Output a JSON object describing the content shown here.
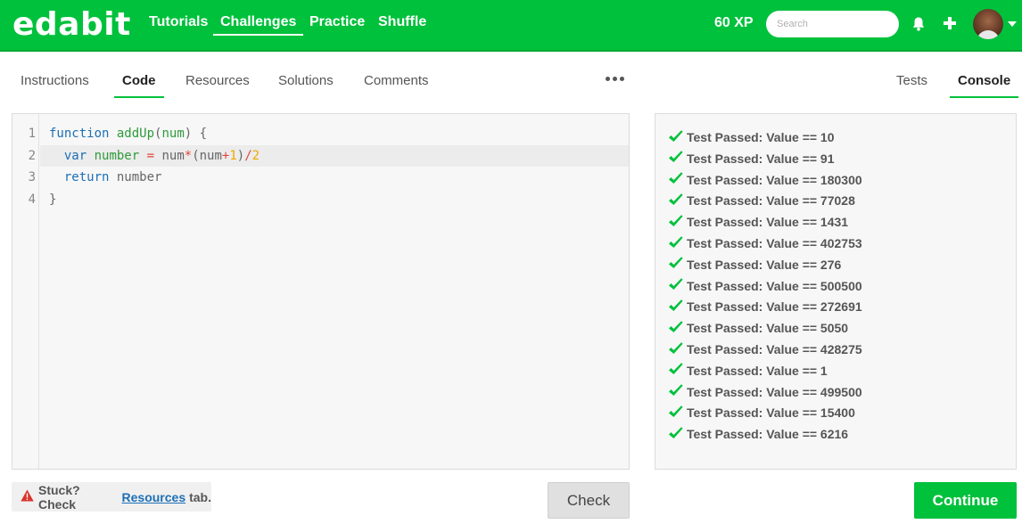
{
  "header": {
    "logo": "edabit",
    "nav": [
      "Tutorials",
      "Challenges",
      "Practice",
      "Shuffle"
    ],
    "active_nav": "Challenges",
    "xp": "60 XP",
    "search_placeholder": "Search"
  },
  "tabs": {
    "left": [
      "Instructions",
      "Code",
      "Resources",
      "Solutions",
      "Comments"
    ],
    "left_active": "Code",
    "right": [
      "Tests",
      "Console"
    ],
    "right_active": "Console"
  },
  "editor": {
    "line_numbers": [
      "1",
      "2",
      "3",
      "4"
    ],
    "highlighted_line": "2",
    "lines": [
      [
        {
          "t": "function",
          "c": "kw"
        },
        {
          "t": " ",
          "c": "punc"
        },
        {
          "t": "addUp",
          "c": "fn"
        },
        {
          "t": "(",
          "c": "punc"
        },
        {
          "t": "num",
          "c": "var"
        },
        {
          "t": ") {",
          "c": "punc"
        }
      ],
      [
        {
          "t": "  ",
          "c": "punc"
        },
        {
          "t": "var",
          "c": "kw"
        },
        {
          "t": " ",
          "c": "punc"
        },
        {
          "t": "number",
          "c": "var"
        },
        {
          "t": " ",
          "c": "punc"
        },
        {
          "t": "=",
          "c": "op"
        },
        {
          "t": " num",
          "c": "id"
        },
        {
          "t": "*",
          "c": "op"
        },
        {
          "t": "(num",
          "c": "id"
        },
        {
          "t": "+",
          "c": "op"
        },
        {
          "t": "1",
          "c": "num"
        },
        {
          "t": ")",
          "c": "id"
        },
        {
          "t": "/",
          "c": "op"
        },
        {
          "t": "2",
          "c": "num"
        }
      ],
      [
        {
          "t": "  ",
          "c": "punc"
        },
        {
          "t": "return",
          "c": "kw"
        },
        {
          "t": " number",
          "c": "id"
        }
      ],
      [
        {
          "t": "}",
          "c": "punc"
        }
      ]
    ]
  },
  "console": {
    "results": [
      "Test Passed: Value == 10",
      "Test Passed: Value == 91",
      "Test Passed: Value == 180300",
      "Test Passed: Value == 77028",
      "Test Passed: Value == 1431",
      "Test Passed: Value == 402753",
      "Test Passed: Value == 276",
      "Test Passed: Value == 500500",
      "Test Passed: Value == 272691",
      "Test Passed: Value == 5050",
      "Test Passed: Value == 428275",
      "Test Passed: Value == 1",
      "Test Passed: Value == 499500",
      "Test Passed: Value == 15400",
      "Test Passed: Value == 6216"
    ]
  },
  "footer": {
    "hint_prefix": "Stuck? Check",
    "hint_link": "Resources",
    "hint_suffix": "tab.",
    "check_label": "Check",
    "continue_label": "Continue"
  },
  "colors": {
    "brand": "#00c13c",
    "link": "#1c6fb5",
    "warning": "#d9342b",
    "check": "#00c13c"
  }
}
